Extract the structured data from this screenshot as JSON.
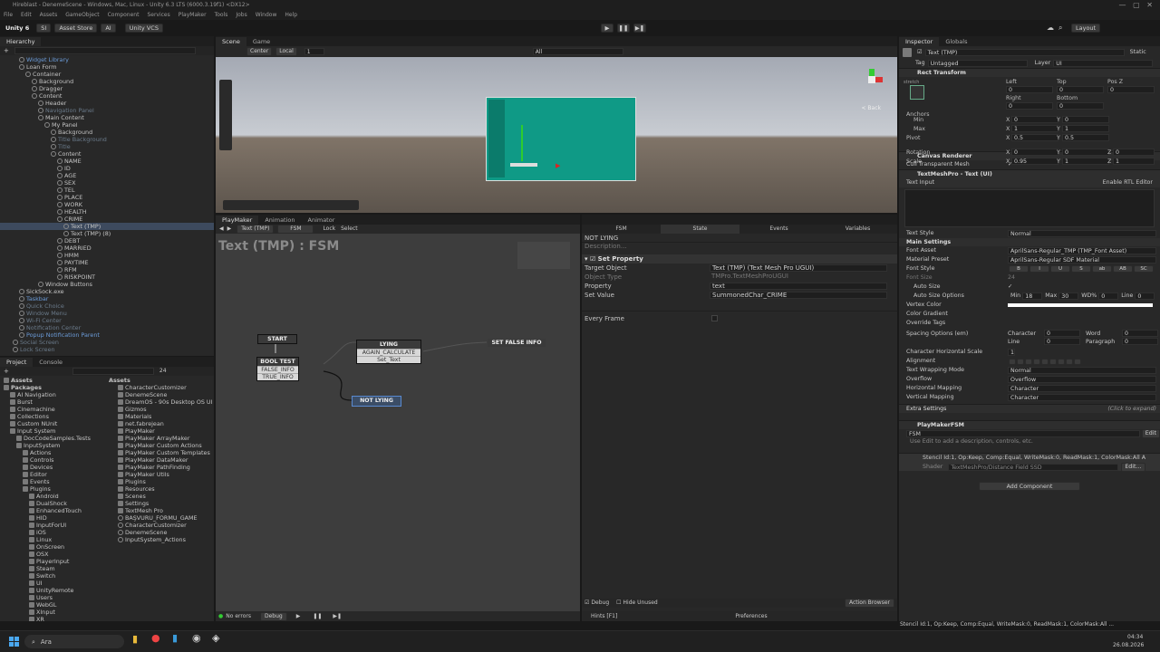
{
  "window": {
    "title": "Hireblast - DenemeScene - Windows, Mac, Linux - Unity 6.3 LTS (6000.3.19f1) <DX12>"
  },
  "menu": [
    "File",
    "Edit",
    "Assets",
    "GameObject",
    "Component",
    "Services",
    "PlayMaker",
    "Tools",
    "Jobs",
    "Window",
    "Help"
  ],
  "toolbar": {
    "unity": "Unity 6",
    "account": "SI",
    "asset_store": "Asset Store",
    "ai": "AI",
    "vcs": "Unity VCS",
    "layout": "Layout"
  },
  "hierarchy": {
    "tab": "Hierarchy",
    "items": [
      {
        "t": "Widget Library",
        "c": "blue",
        "i": 3
      },
      {
        "t": "Loan Form",
        "c": "",
        "i": 3
      },
      {
        "t": "Container",
        "c": "",
        "i": 4
      },
      {
        "t": "Background",
        "c": "",
        "i": 5
      },
      {
        "t": "Dragger",
        "c": "",
        "i": 5
      },
      {
        "t": "Content",
        "c": "",
        "i": 5
      },
      {
        "t": "Header",
        "c": "",
        "i": 6
      },
      {
        "t": "Navigation Panel",
        "c": "dim",
        "i": 6
      },
      {
        "t": "Main Content",
        "c": "",
        "i": 6
      },
      {
        "t": "My Panel",
        "c": "",
        "i": 7
      },
      {
        "t": "Background",
        "c": "",
        "i": 8
      },
      {
        "t": "Title Background",
        "c": "dim",
        "i": 8
      },
      {
        "t": "Title",
        "c": "dim",
        "i": 8
      },
      {
        "t": "Content",
        "c": "",
        "i": 8
      },
      {
        "t": "NAME",
        "c": "",
        "i": 9
      },
      {
        "t": "ID",
        "c": "",
        "i": 9
      },
      {
        "t": "AGE",
        "c": "",
        "i": 9
      },
      {
        "t": "SEX",
        "c": "",
        "i": 9
      },
      {
        "t": "TEL",
        "c": "",
        "i": 9
      },
      {
        "t": "PLACE",
        "c": "",
        "i": 9
      },
      {
        "t": "WORK",
        "c": "",
        "i": 9
      },
      {
        "t": "HEALTH",
        "c": "",
        "i": 9
      },
      {
        "t": "CRIME",
        "c": "",
        "i": 9
      },
      {
        "t": "Text (TMP)",
        "c": "sel",
        "i": 10
      },
      {
        "t": "Text (TMP) (8)",
        "c": "",
        "i": 10
      },
      {
        "t": "DEBT",
        "c": "",
        "i": 9
      },
      {
        "t": "MARRIED",
        "c": "",
        "i": 9
      },
      {
        "t": "HMM",
        "c": "",
        "i": 9
      },
      {
        "t": "PAYTIME",
        "c": "",
        "i": 9
      },
      {
        "t": "RFM",
        "c": "",
        "i": 9
      },
      {
        "t": "RISKPOINT",
        "c": "",
        "i": 9
      },
      {
        "t": "Window Buttons",
        "c": "",
        "i": 6
      },
      {
        "t": "SickSock.exe",
        "c": "",
        "i": 3
      },
      {
        "t": "Taskbar",
        "c": "blue",
        "i": 3
      },
      {
        "t": "Quick Choice",
        "c": "dim",
        "i": 3
      },
      {
        "t": "Window Menu",
        "c": "dim",
        "i": 3
      },
      {
        "t": "Wi-Fi Center",
        "c": "dim",
        "i": 3
      },
      {
        "t": "Notification Center",
        "c": "dim",
        "i": 3
      },
      {
        "t": "Popup Notification Parent",
        "c": "blue",
        "i": 3
      },
      {
        "t": "Social Screen",
        "c": "dim",
        "i": 2
      },
      {
        "t": "Lock Screen",
        "c": "dim",
        "i": 2
      }
    ]
  },
  "project": {
    "tabs": [
      "Project",
      "Console"
    ],
    "count": "24",
    "tree": [
      {
        "t": "Assets",
        "i": 0,
        "b": true
      },
      {
        "t": "Packages",
        "i": 0,
        "b": true
      },
      {
        "t": "AI Navigation",
        "i": 1
      },
      {
        "t": "Burst",
        "i": 1
      },
      {
        "t": "Cinemachine",
        "i": 1
      },
      {
        "t": "Collections",
        "i": 1
      },
      {
        "t": "Custom NUnit",
        "i": 1
      },
      {
        "t": "Input System",
        "i": 1
      },
      {
        "t": "DocCodeSamples.Tests",
        "i": 2
      },
      {
        "t": "InputSystem",
        "i": 2
      },
      {
        "t": "Actions",
        "i": 3
      },
      {
        "t": "Controls",
        "i": 3
      },
      {
        "t": "Devices",
        "i": 3
      },
      {
        "t": "Editor",
        "i": 3
      },
      {
        "t": "Events",
        "i": 3
      },
      {
        "t": "Plugins",
        "i": 3
      },
      {
        "t": "Android",
        "i": 4
      },
      {
        "t": "DualShock",
        "i": 4
      },
      {
        "t": "EnhancedTouch",
        "i": 4
      },
      {
        "t": "HID",
        "i": 4
      },
      {
        "t": "InputForUI",
        "i": 4
      },
      {
        "t": "iOS",
        "i": 4
      },
      {
        "t": "Linux",
        "i": 4
      },
      {
        "t": "OnScreen",
        "i": 4
      },
      {
        "t": "OSX",
        "i": 4
      },
      {
        "t": "PlayerInput",
        "i": 4
      },
      {
        "t": "Steam",
        "i": 4
      },
      {
        "t": "Switch",
        "i": 4
      },
      {
        "t": "UI",
        "i": 4
      },
      {
        "t": "UnityRemote",
        "i": 4
      },
      {
        "t": "Users",
        "i": 4
      },
      {
        "t": "WebGL",
        "i": 4
      },
      {
        "t": "XInput",
        "i": 4
      },
      {
        "t": "XR",
        "i": 4
      }
    ],
    "assets_header": "Assets",
    "assets": [
      "CharacterCustomizer",
      "DenemeScene",
      "DreamOS - 90s Desktop OS UI",
      "Gizmos",
      "Materials",
      "net.fabrejean",
      "PlayMaker",
      "PlayMaker ArrayMaker",
      "PlayMaker Custom Actions",
      "PlayMaker Custom Templates",
      "PlayMaker DataMaker",
      "PlayMaker PathFinding",
      "PlayMaker Utils",
      "Plugins",
      "Resources",
      "Scenes",
      "Settings",
      "TextMesh Pro",
      "BAŞVURU_FORMU_GAME",
      "CharacterCustomizer",
      "DenemeScene",
      "InputSystem_Actions"
    ]
  },
  "scene": {
    "tabs": [
      "Scene",
      "Game"
    ],
    "pivot": "Center",
    "space": "Local",
    "snap": "1",
    "search": "All",
    "back": "< Back"
  },
  "playmaker": {
    "tabs": [
      "PlayMaker",
      "Animation",
      "Animator"
    ],
    "object": "Text (TMP)",
    "fsm": "FSM",
    "lock": "Lock",
    "select": "Select",
    "title": "Text (TMP) : FSM",
    "start": "START",
    "nodes": {
      "bool_title": "BOOL TEST",
      "bool_false": "FALSE_INFO",
      "bool_true": "TRUE_INFO",
      "lying_title": "LYING",
      "lying_e1": "AGAIN_CALCULATE",
      "lying_e2": "Set_Text",
      "false_info": "SET FALSE INFO",
      "not_lying": "NOT LYING"
    },
    "status": {
      "errors": "No errors",
      "debug": "Debug",
      "hints": "Hints [F1]",
      "prefs": "Preferences",
      "browser": "Action Browser",
      "debug_cb": "Debug",
      "hide": "Hide Unused"
    },
    "side_tabs": [
      "FSM",
      "State",
      "Events",
      "Variables"
    ],
    "state_name": "NOT LYING",
    "desc": "Description...",
    "action": "Set Property",
    "props": [
      {
        "k": "Target Object",
        "v": "Text (TMP) (Text Mesh Pro UGUI)"
      },
      {
        "k": "Object Type",
        "v": "TMPro.TextMeshProUGUI"
      },
      {
        "k": "Property",
        "v": "text"
      },
      {
        "k": "Set Value",
        "v": "SummonedChar_CRIME"
      }
    ],
    "every_frame": "Every Frame"
  },
  "inspector": {
    "tabs": [
      "Inspector",
      "Globals"
    ],
    "name": "Text (TMP)",
    "static": "Static",
    "tag_label": "Tag",
    "tag": "Untagged",
    "layer_label": "Layer",
    "layer": "UI",
    "rect": "Rect Transform",
    "stretch": "stretch",
    "rect_heads": [
      "Left",
      "Top",
      "Pos Z",
      "Right",
      "Bottom"
    ],
    "rect_vals": [
      "0",
      "0",
      "0",
      "0",
      "0"
    ],
    "anchors": "Anchors",
    "min": "Min",
    "max": "Max",
    "pivot": "Pivot",
    "rotation": "Rotation",
    "scale": "Scale",
    "min_xy": [
      "0",
      "0"
    ],
    "max_xy": [
      "1",
      "1"
    ],
    "pivot_xy": [
      "0.5",
      "0.5"
    ],
    "rot": [
      "0",
      "0",
      "0"
    ],
    "scl": [
      "0.95",
      "1",
      "1"
    ],
    "canvas": "Canvas Renderer",
    "cull": "Cull Transparent Mesh",
    "tmp": "TextMeshPro - Text (UI)",
    "text_input": "Text Input",
    "rtl": "Enable RTL Editor",
    "text_style_l": "Text Style",
    "text_style": "Normal",
    "main": "Main Settings",
    "font_asset_l": "Font Asset",
    "font_asset": "AprilSans-Regular_TMP (TMP_Font Asset)",
    "mat_l": "Material Preset",
    "mat": "AprilSans-Regular SDF Material",
    "font_style": "Font Style",
    "styles": [
      "B",
      "I",
      "U",
      "S",
      "ab",
      "AB",
      "SC"
    ],
    "font_size": "Font Size",
    "font_size_v": "24",
    "auto_size": "Auto Size",
    "auto_opts": "Auto Size Options",
    "auto_vals": {
      "min_l": "Min",
      "min": "18",
      "max_l": "Max",
      "max": "30",
      "wd_l": "WD%",
      "wd": "0",
      "line_l": "Line",
      "line": "0"
    },
    "vertex": "Vertex Color",
    "gradient": "Color Gradient",
    "override": "Override Tags",
    "spacing": "Spacing Options (em)",
    "sp_labels": [
      "Character",
      "Word",
      "Line",
      "Paragraph"
    ],
    "sp_vals": [
      "0",
      "0",
      "0",
      "0"
    ],
    "chs": "Character Horizontal Scale",
    "chs_v": "1",
    "align": "Alignment",
    "wrap_l": "Text Wrapping Mode",
    "wrap": "Normal",
    "overflow_l": "Overflow",
    "overflow": "Overflow",
    "hmap_l": "Horizontal Mapping",
    "hmap": "Character",
    "vmap_l": "Vertical Mapping",
    "vmap": "Character",
    "extra": "Extra Settings",
    "expand": "(Click to expand)",
    "pmfsm": "PlayMakerFSM",
    "fsm": "FSM",
    "edit": "Edit",
    "fsm_desc": "Use Edit to add a description, controls, etc.",
    "stencil": "Stencil Id:1, Op:Keep, Comp:Equal, WriteMask:0, ReadMask:1, ColorMask:All A",
    "shader_l": "Shader",
    "shader": "TextMeshPro/Distance Field SSD",
    "shader_edit": "Edit...",
    "add": "Add Component",
    "status": "Stencil Id:1, Op:Keep, Comp:Equal, WriteMask:0, ReadMask:1, ColorMask:All ..."
  },
  "taskbar": {
    "search": "Ara",
    "time": "04:34",
    "date": "26.08.2026"
  }
}
